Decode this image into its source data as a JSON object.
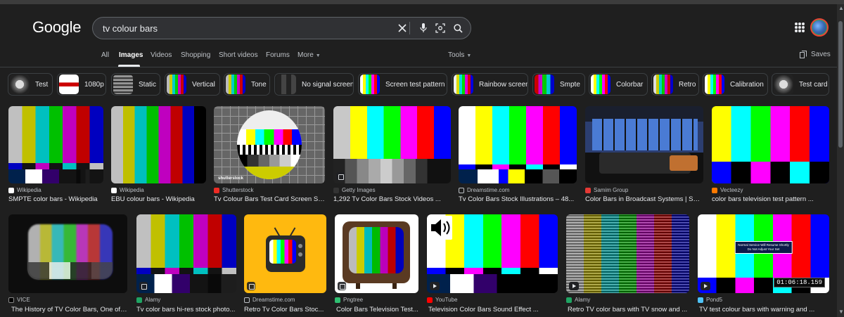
{
  "header": {
    "logo_text": "Google",
    "search": {
      "query": "tv colour bars"
    },
    "icons": {
      "clear": "close-icon",
      "voice": "microphone-icon",
      "lens": "camera-lens-icon",
      "search": "search-icon",
      "apps": "apps-grid-icon"
    }
  },
  "tabs": [
    {
      "label": "All",
      "active": false
    },
    {
      "label": "Images",
      "active": true
    },
    {
      "label": "Videos",
      "active": false
    },
    {
      "label": "Shopping",
      "active": false
    },
    {
      "label": "Short videos",
      "active": false
    },
    {
      "label": "Forums",
      "active": false
    },
    {
      "label": "More",
      "active": false
    }
  ],
  "tools_label": "Tools",
  "saves_label": "Saves",
  "chips": [
    {
      "label": "Test"
    },
    {
      "label": "1080p"
    },
    {
      "label": "Static"
    },
    {
      "label": "Vertical"
    },
    {
      "label": "Tone"
    },
    {
      "label": "No signal screen"
    },
    {
      "label": "Screen test pattern"
    },
    {
      "label": "Rainbow screen"
    },
    {
      "label": "Smpte"
    },
    {
      "label": "Colorbar"
    },
    {
      "label": "Retro"
    },
    {
      "label": "Calibration"
    },
    {
      "label": "Test card"
    }
  ],
  "results_row1": [
    {
      "source": "Wikipedia",
      "title": "SMPTE color bars - Wikipedia"
    },
    {
      "source": "Wikipedia",
      "title": "EBU colour bars - Wikipedia"
    },
    {
      "source": "Shutterstock",
      "title": "Tv Colour Bars Test Card Screen St...",
      "watermark": "shutterstock"
    },
    {
      "source": "Getty Images",
      "title": "1,292 Tv Color Bars Stock Videos ..."
    },
    {
      "source": "Dreamstime.com",
      "title": "Tv Color Bars Stock Illustrations – 48..."
    },
    {
      "source": "Samim Group",
      "title": "Color Bars in Broadcast Systems | Sa..."
    },
    {
      "source": "Vecteezy",
      "title": "color bars television test pattern ..."
    }
  ],
  "results_row2": [
    {
      "source": "VICE",
      "title": "The History of TV Color Bars, One of ..."
    },
    {
      "source": "Alamy",
      "title": "Tv color bars hi-res stock photo..."
    },
    {
      "source": "Dreamstime.com",
      "title": "Retro Tv Color Bars Stoc..."
    },
    {
      "source": "Pngtree",
      "title": "Color Bars Television Test..."
    },
    {
      "source": "YouTube",
      "title": "Television Color Bars Sound Effect ..."
    },
    {
      "source": "Alamy",
      "title": "Retro TV color bars with TV snow and ..."
    },
    {
      "source": "Pond5",
      "title": "TV test colour bars with warning and ...",
      "overlay_line1": "Normal Service Will Resume Shortly",
      "overlay_line2": "Do Not Adjust Your Set",
      "timecode": "01:06:18.159"
    }
  ]
}
